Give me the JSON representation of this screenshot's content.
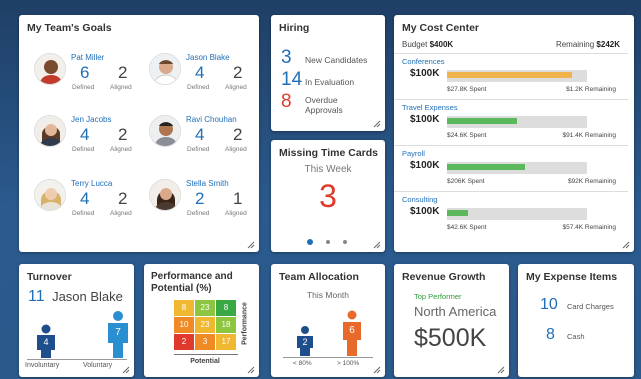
{
  "team_goals": {
    "title": "My Team's Goals",
    "defined_label": "Defined",
    "aligned_label": "Aligned",
    "members": [
      {
        "name": "Pat Miller",
        "defined": "6",
        "aligned": "2"
      },
      {
        "name": "Jason Blake",
        "defined": "4",
        "aligned": "2"
      },
      {
        "name": "Jen Jacobs",
        "defined": "4",
        "aligned": "2"
      },
      {
        "name": "Ravi Chouhan",
        "defined": "4",
        "aligned": "2"
      },
      {
        "name": "Terry Lucca",
        "defined": "4",
        "aligned": "2"
      },
      {
        "name": "Stella Smith",
        "defined": "2",
        "aligned": "1"
      }
    ]
  },
  "hiring": {
    "title": "Hiring",
    "rows": [
      {
        "value": "3",
        "label": "New Candidates",
        "color": "#1f6fb8"
      },
      {
        "value": "14",
        "label": "In Evaluation",
        "color": "#1f6fb8"
      },
      {
        "value": "8",
        "label": "Overdue Approvals",
        "color": "#e03a2c"
      }
    ]
  },
  "missing_time": {
    "title": "Missing Time Cards",
    "subtitle": "This Week",
    "value": "3",
    "value_color": "#e03a2c"
  },
  "cost_center": {
    "title": "My Cost Center",
    "budget_label": "Budget",
    "budget_value": "$400K",
    "remaining_label": "Remaining",
    "remaining_value": "$242K",
    "categories": [
      {
        "name": "Conferences",
        "amount": "$100K",
        "spent": "$27.8K Spent",
        "remaining": "$1.2K Remaining",
        "fill": 0.89,
        "color": "#f0b24a"
      },
      {
        "name": "Travel Expenses",
        "amount": "$100K",
        "spent": "$24.6K Spent",
        "remaining": "$91.4K Remaining",
        "fill": 0.5,
        "color": "#5cb85c"
      },
      {
        "name": "Payroll",
        "amount": "$100K",
        "spent": "$206K Spent",
        "remaining": "$92K Remaining",
        "fill": 0.56,
        "color": "#5cb85c"
      },
      {
        "name": "Consulting",
        "amount": "$100K",
        "spent": "$42.6K Spent",
        "remaining": "$57.4K Remaining",
        "fill": 0.15,
        "color": "#5cb85c"
      }
    ]
  },
  "turnover": {
    "title": "Turnover",
    "count": "11",
    "name": "Jason Blake",
    "voluntary_label": "Voluntary",
    "involuntary_label": "Involuntary",
    "involuntary_value": "4",
    "voluntary_value": "7",
    "colors": {
      "involuntary": "#1f4e8c",
      "voluntary": "#2a8fd0"
    }
  },
  "performance": {
    "title_line1": "Performance and",
    "title_line2": "Potential (%)",
    "y_label": "Performance",
    "x_label": "Potential",
    "cells": [
      {
        "v": "8",
        "c": "#f0b830"
      },
      {
        "v": "23",
        "c": "#8cc63f"
      },
      {
        "v": "8",
        "c": "#3aa845"
      },
      {
        "v": "10",
        "c": "#f08a24"
      },
      {
        "v": "23",
        "c": "#f0b830"
      },
      {
        "v": "18",
        "c": "#8cc63f"
      },
      {
        "v": "2",
        "c": "#e03a2c"
      },
      {
        "v": "3",
        "c": "#f08a24"
      },
      {
        "v": "17",
        "c": "#f0b830"
      }
    ]
  },
  "team_allocation": {
    "title": "Team Allocation",
    "subtitle": "This Month",
    "left_value": "2",
    "right_value": "6",
    "left_label": "< 80%",
    "right_label": "> 100%",
    "colors": {
      "left": "#1f4e8c",
      "right": "#e86a2a"
    }
  },
  "revenue": {
    "title": "Revenue Growth",
    "subtitle": "Top Performer",
    "region": "North America",
    "value": "$500K"
  },
  "expenses": {
    "title": "My Expense Items",
    "rows": [
      {
        "value": "10",
        "label": "Card Charges"
      },
      {
        "value": "8",
        "label": "Cash"
      }
    ]
  }
}
